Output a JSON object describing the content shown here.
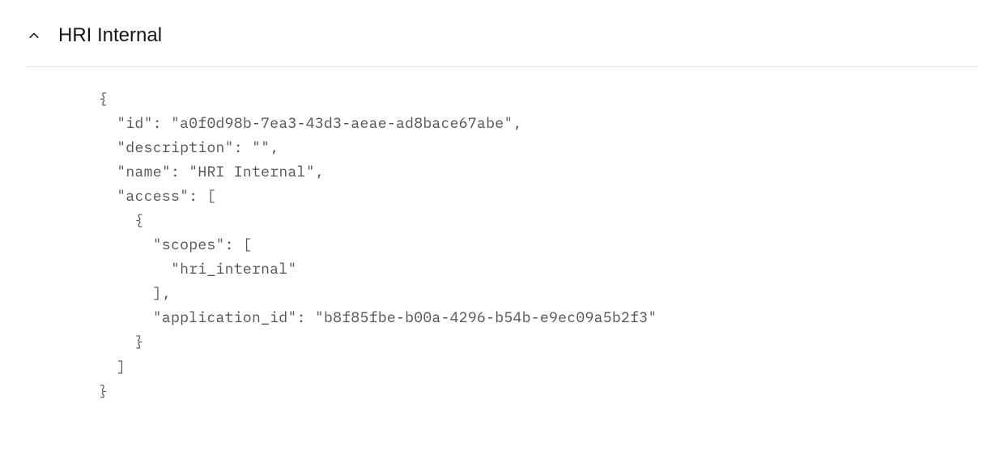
{
  "panel": {
    "title": "HRI Internal"
  },
  "code": {
    "lines": [
      "{",
      "  \"id\": \"a0f0d98b-7ea3-43d3-aeae-ad8bace67abe\",",
      "  \"description\": \"\",",
      "  \"name\": \"HRI Internal\",",
      "  \"access\": [",
      "    {",
      "      \"scopes\": [",
      "        \"hri_internal\"",
      "      ],",
      "      \"application_id\": \"b8f85fbe-b00a-4296-b54b-e9ec09a5b2f3\"",
      "    }",
      "  ]",
      "}"
    ]
  }
}
